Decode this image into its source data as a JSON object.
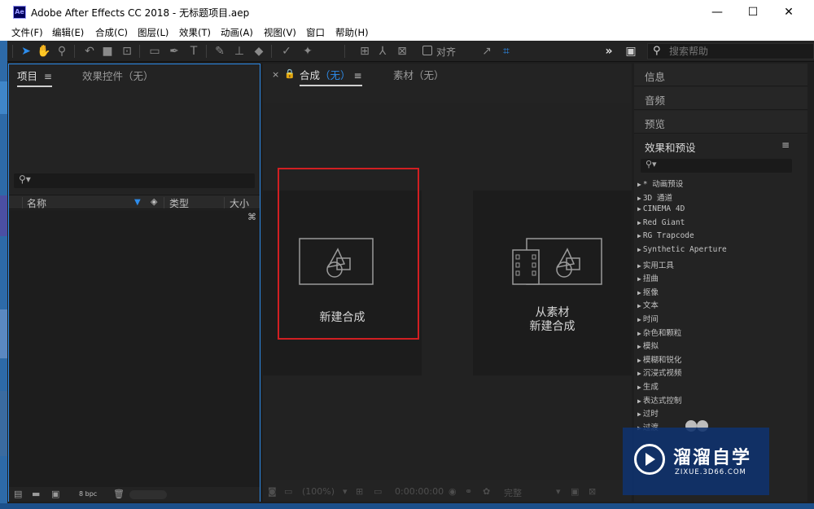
{
  "window": {
    "icon_text": "Ae",
    "title": "Adobe After Effects CC 2018 - 无标题项目.aep",
    "minimize": "—",
    "maximize": "☐",
    "close": "✕"
  },
  "menu": [
    "文件(F)",
    "编辑(E)",
    "合成(C)",
    "图层(L)",
    "效果(T)",
    "动画(A)",
    "视图(V)",
    "窗口",
    "帮助(H)"
  ],
  "toolbar": {
    "align_label": "对齐",
    "expand": "»",
    "search_placeholder": "搜索帮助"
  },
  "project_panel": {
    "tab_project": "项目",
    "tab_effects_controls": "效果控件（无）",
    "columns": {
      "name": "名称",
      "type": "类型",
      "size": "大小"
    },
    "bpc": "8 bpc"
  },
  "comp_panel": {
    "close_x": "×",
    "tab_comp_label": "合成",
    "tab_comp_value": "（无）",
    "tab_footage": "素材（无）",
    "new_comp_label": "新建合成",
    "from_footage_line1": "从素材",
    "from_footage_line2": "新建合成",
    "footer_zoom": "(100%)",
    "footer_time": "0:00:00:00",
    "footer_quality": "完整"
  },
  "right_panel": {
    "sections": [
      "信息",
      "音频",
      "预览",
      "效果和预设"
    ],
    "effects": [
      "* 动画预设",
      "3D 通道",
      "CINEMA 4D",
      "Red Giant",
      "RG Trapcode",
      "Synthetic Aperture",
      "实用工具",
      "扭曲",
      "抠像",
      "文本",
      "时间",
      "杂色和颗粒",
      "模拟",
      "模糊和锐化",
      "沉浸式视频",
      "生成",
      "表达式控制",
      "过时",
      "过渡"
    ]
  },
  "watermark": {
    "title": "溜溜自学",
    "subtitle": "ZIXUE.3D66.COM"
  },
  "colors": {
    "accent_blue": "#2d8ceb",
    "highlight_red": "#d11f22",
    "panel_bg": "#232323"
  }
}
